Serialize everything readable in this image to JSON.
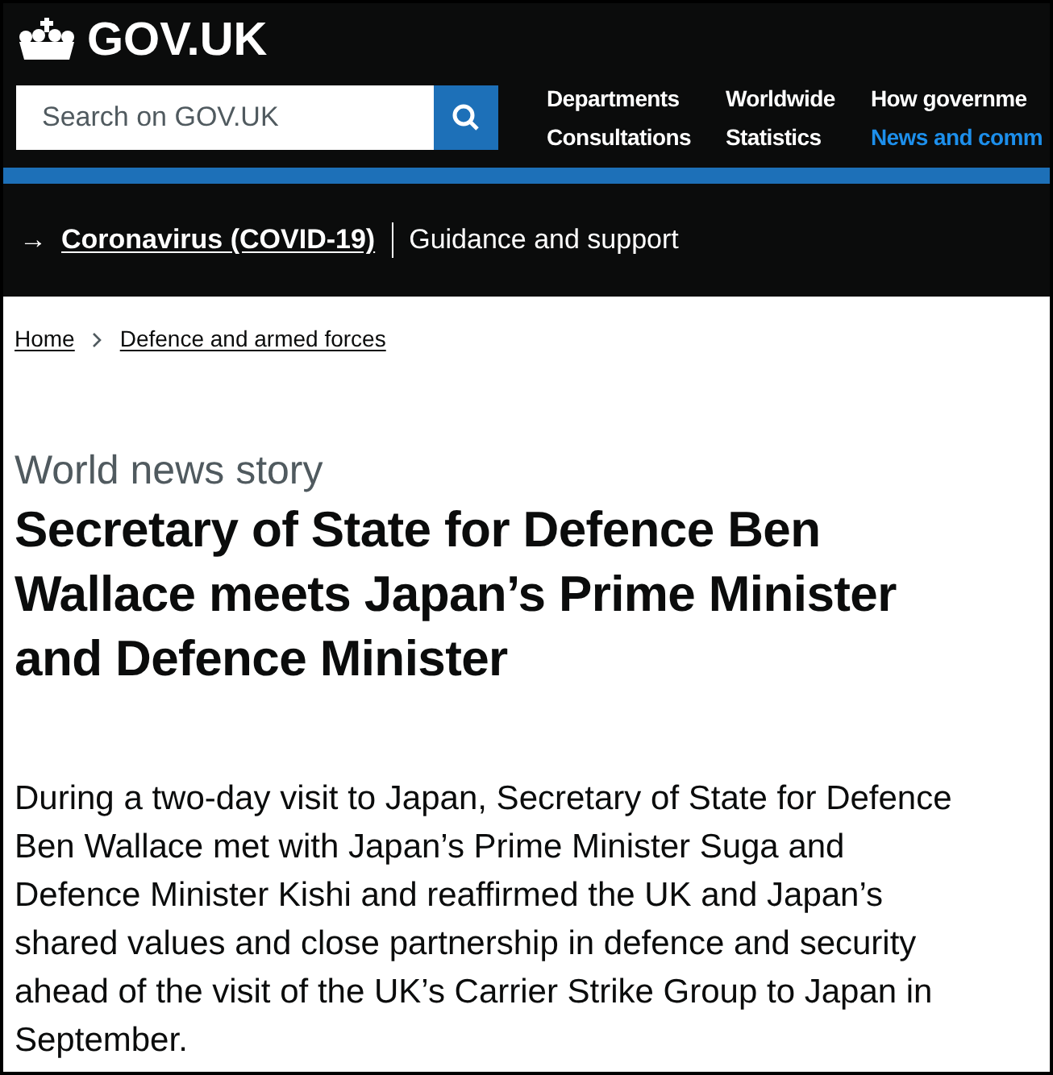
{
  "header": {
    "logo": "GOV.UK",
    "search": {
      "placeholder": "Search on GOV.UK"
    },
    "nav": [
      {
        "label": "Departments",
        "selected": false
      },
      {
        "label": "Worldwide",
        "selected": false
      },
      {
        "label": "How governme",
        "selected": false
      },
      {
        "label": "Consultations",
        "selected": false
      },
      {
        "label": "Statistics",
        "selected": false
      },
      {
        "label": "News and comm",
        "selected": true
      }
    ]
  },
  "banner": {
    "arrow": "→",
    "link": "Coronavirus (COVID-19)",
    "text": "Guidance and support"
  },
  "breadcrumbs": [
    {
      "label": "Home"
    },
    {
      "label": "Defence and armed forces"
    }
  ],
  "article": {
    "kind": "World news story",
    "title": "Secretary of State for Defence Ben Wallace meets Japan’s Prime Minister and Defence Minister",
    "lead": "During a two-day visit to Japan, Secretary of State for Defence Ben Wallace met with Japan’s Prime Minister Suga and Defence Minister Kishi and reaffirmed the UK and Japan’s shared values and close partnership in defence and security ahead of the visit of the UK’s Carrier Strike Group to Japan in September."
  }
}
